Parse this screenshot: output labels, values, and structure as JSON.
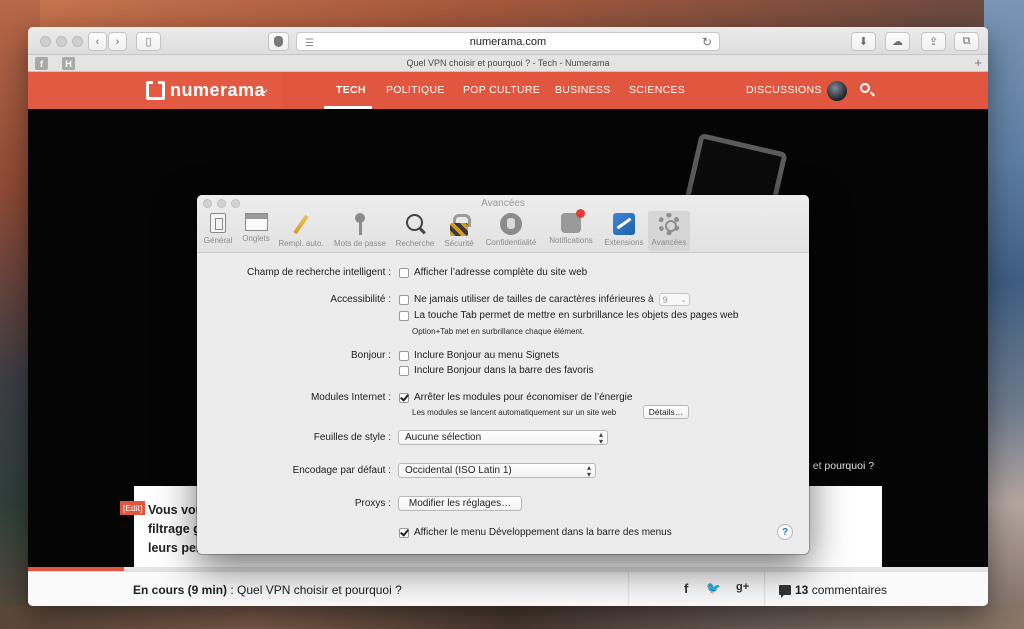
{
  "browser": {
    "url": "numerama.com",
    "tab_title": "Quel VPN choisir et pourquoi ? - Tech - Numerama",
    "tab_plus": "+",
    "back": "‹",
    "forward": "›",
    "sidebar": "▯",
    "reload": "↻",
    "reader": "☰",
    "download": "⬇",
    "share": "⇪",
    "tabs": "⧉",
    "fav_f": "f",
    "fav_h": "H"
  },
  "site": {
    "logo": "numerama",
    "logo_chevron": "⌄",
    "nav": [
      "TECH",
      "POLITIQUE",
      "POP CULTURE",
      "BUSINESS",
      "SCIENCES"
    ],
    "discussions": "DISCUSSIONS",
    "side_headline": "ir et pourquoi ?",
    "edit_tag": "[Edit]",
    "article_title": "Vous vou\nfiltrage g\nleurs per",
    "progress_fraction": 0.1
  },
  "bottom": {
    "status_bold": "En cours (9 min)",
    "status_rest": " : Quel VPN choisir et pourquoi ?",
    "share_icons": [
      "f",
      "🐦",
      "g+"
    ],
    "comments_count": "13",
    "comments_label": " commentaires"
  },
  "prefs": {
    "title": "Avancées",
    "tabs": [
      {
        "label": "Général",
        "icon": "general-icon"
      },
      {
        "label": "Onglets",
        "icon": "tabs-icon"
      },
      {
        "label": "Rempl. auto.",
        "icon": "pencil-icon"
      },
      {
        "label": "Mots de passe",
        "icon": "key-icon"
      },
      {
        "label": "Recherche",
        "icon": "search-icon"
      },
      {
        "label": "Sécurité",
        "icon": "lock-icon"
      },
      {
        "label": "Confidentialité",
        "icon": "privacy-hand-icon"
      },
      {
        "label": "Notifications",
        "icon": "notifications-icon"
      },
      {
        "label": "Extensions",
        "icon": "extensions-icon"
      },
      {
        "label": "Avancées",
        "icon": "gear-icon"
      }
    ],
    "rows": {
      "search_label": "Champ de recherche intelligent :",
      "search_opt": "Afficher l’adresse complète du site web",
      "access_label": "Accessibilité :",
      "access_opt1": "Ne jamais utiliser de tailles de caractères inférieures à",
      "access_size": "9",
      "access_opt2": "La touche Tab permet de mettre en surbrillance les objets des pages web",
      "access_hint": "Option+Tab met en surbrillance chaque élément.",
      "bonjour_label": "Bonjour :",
      "bonjour_opt1": "Inclure Bonjour au menu Signets",
      "bonjour_opt2": "Inclure Bonjour dans la barre des favoris",
      "modules_label": "Modules Internet :",
      "modules_opt": "Arrêter les modules pour économiser de l’énergie",
      "modules_hint": "Les modules se lancent automatiquement sur un site web",
      "modules_details": "Détails…",
      "style_label": "Feuilles de style :",
      "style_value": "Aucune sélection",
      "encoding_label": "Encodage par défaut :",
      "encoding_value": "Occidental (ISO Latin 1)",
      "proxy_label": "Proxys :",
      "proxy_button": "Modifier les réglages…",
      "dev_opt": "Afficher le menu Développement dans la barre des menus",
      "help": "?"
    }
  }
}
